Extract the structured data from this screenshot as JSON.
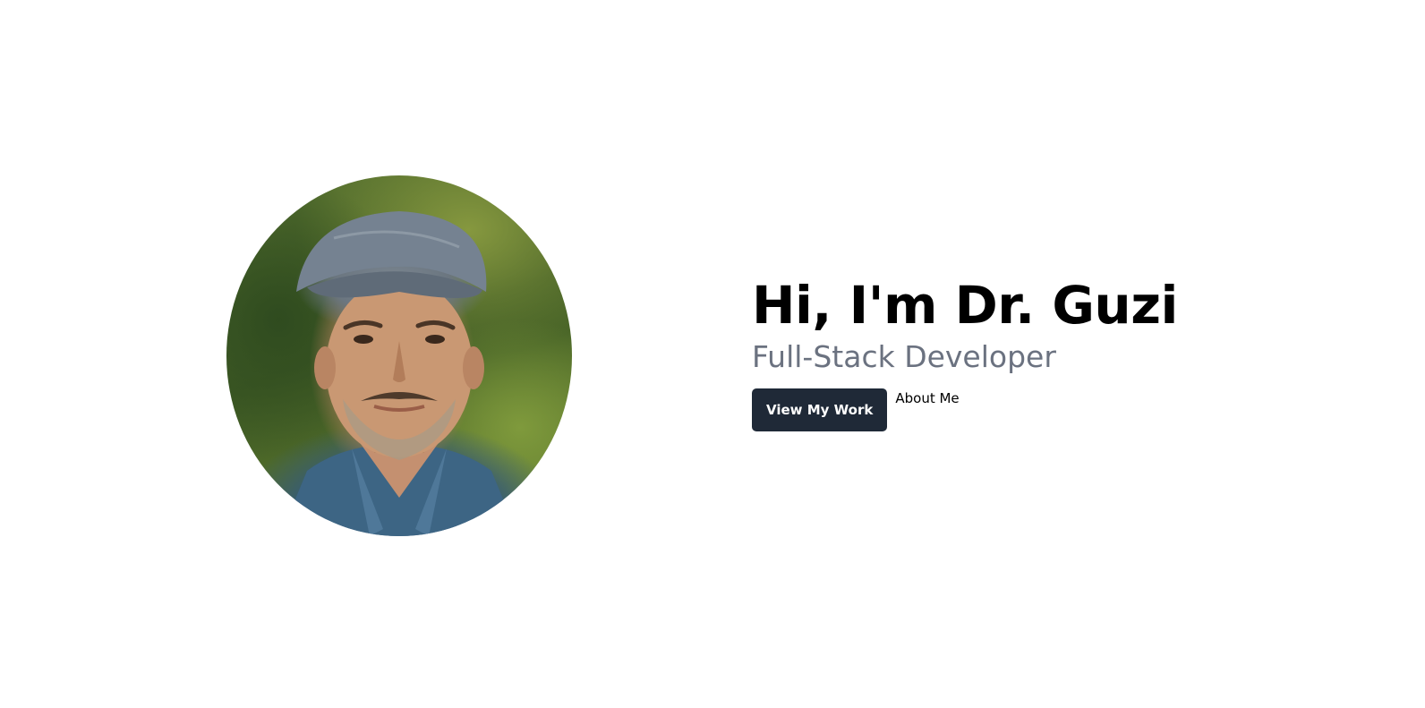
{
  "hero": {
    "portrait_alt": "portrait-photo",
    "heading": "Hi, I'm Dr. Guzi",
    "subheading": "Full-Stack Developer",
    "primary_button": "View My Work",
    "secondary_link": "About Me"
  },
  "colors": {
    "background": "#ffffff",
    "heading": "#000000",
    "subheading": "#6b7280",
    "button_bg": "#1f2937",
    "button_text": "#ffffff"
  }
}
